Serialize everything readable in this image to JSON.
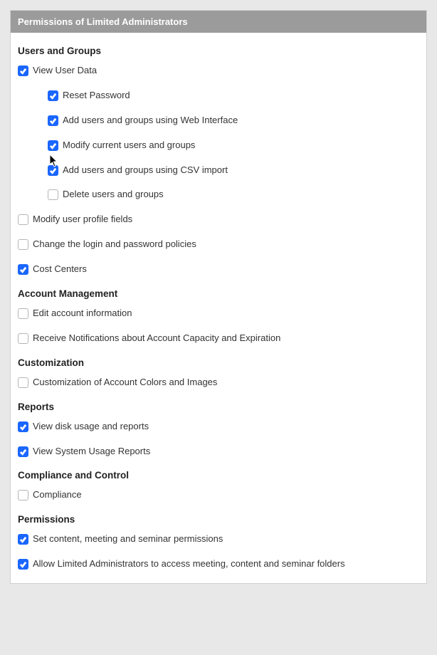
{
  "panel": {
    "title": "Permissions of Limited Administrators"
  },
  "sections": {
    "users_groups": {
      "title": "Users and Groups",
      "view_user_data": {
        "label": "View User Data",
        "checked": true
      },
      "reset_password": {
        "label": "Reset Password",
        "checked": true
      },
      "add_web": {
        "label": "Add users and groups using Web Interface",
        "checked": true
      },
      "modify_current": {
        "label": "Modify current users and groups",
        "checked": true
      },
      "add_csv": {
        "label": "Add users and groups using CSV import",
        "checked": true
      },
      "delete_ug": {
        "label": "Delete users and groups",
        "checked": false
      },
      "modify_profile": {
        "label": "Modify user profile fields",
        "checked": false
      },
      "change_login": {
        "label": "Change the login and password policies",
        "checked": false
      },
      "cost_centers": {
        "label": "Cost Centers",
        "checked": true
      }
    },
    "account": {
      "title": "Account Management",
      "edit_account": {
        "label": "Edit account information",
        "checked": false
      },
      "receive_notif": {
        "label": "Receive Notifications about Account Capacity and Expiration",
        "checked": false
      }
    },
    "customization": {
      "title": "Customization",
      "colors_images": {
        "label": "Customization of Account Colors and Images",
        "checked": false
      }
    },
    "reports": {
      "title": "Reports",
      "disk_usage": {
        "label": "View disk usage and reports",
        "checked": true
      },
      "system_usage": {
        "label": "View System Usage Reports",
        "checked": true
      }
    },
    "compliance": {
      "title": "Compliance and Control",
      "compliance_item": {
        "label": "Compliance",
        "checked": false
      }
    },
    "permissions": {
      "title": "Permissions",
      "set_content": {
        "label": "Set content, meeting and seminar permissions",
        "checked": true
      },
      "allow_limited": {
        "label": "Allow Limited Administrators to access meeting, content and seminar folders",
        "checked": true
      }
    }
  }
}
